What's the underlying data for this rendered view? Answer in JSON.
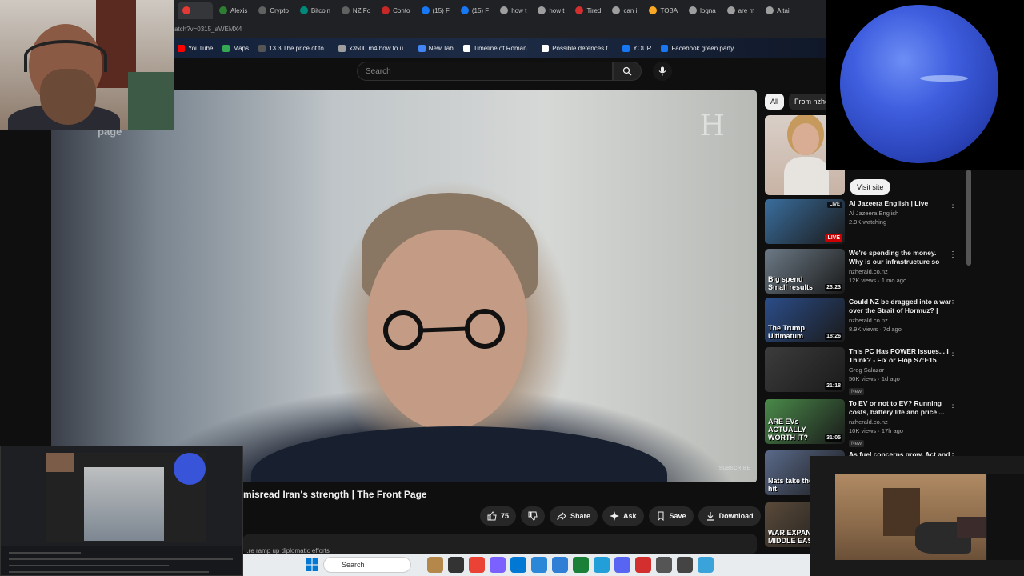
{
  "browser": {
    "tabs": [
      {
        "label": "",
        "color": "#e53935"
      },
      {
        "label": "Alexis",
        "color": "#2e7d32"
      },
      {
        "label": "Crypto",
        "color": "#616161"
      },
      {
        "label": "Bitcoin",
        "color": "#00897b"
      },
      {
        "label": "NZ Fo",
        "color": "#616161"
      },
      {
        "label": "Conto",
        "color": "#c62828"
      },
      {
        "label": "(15) F",
        "color": "#1877f2"
      },
      {
        "label": "(15) F",
        "color": "#1877f2"
      },
      {
        "label": "how t",
        "color": "#9e9e9e"
      },
      {
        "label": "how t",
        "color": "#9e9e9e"
      },
      {
        "label": "Tired",
        "color": "#d32f2f"
      },
      {
        "label": "can i",
        "color": "#9e9e9e"
      },
      {
        "label": "TOBA",
        "color": "#f9a825"
      },
      {
        "label": "logna",
        "color": "#9e9e9e"
      },
      {
        "label": "are m",
        "color": "#9e9e9e"
      },
      {
        "label": "Altai",
        "color": "#9e9e9e"
      }
    ],
    "url": "atch?v=0315_aWEMX4",
    "bookmarks": [
      {
        "label": "YouTube",
        "color": "#ff0000"
      },
      {
        "label": "Maps",
        "color": "#34a853"
      },
      {
        "label": "13.3 The price of to...",
        "color": "#555555"
      },
      {
        "label": "x3500 m4 how to u...",
        "color": "#9e9e9e"
      },
      {
        "label": "New Tab",
        "color": "#4285f4"
      },
      {
        "label": "Timeline of Roman...",
        "color": "#ffffff"
      },
      {
        "label": "Possible defences t...",
        "color": "#ffffff"
      },
      {
        "label": "YOUR",
        "color": "#1877f2"
      },
      {
        "label": "Facebook green party",
        "color": "#1877f2"
      }
    ]
  },
  "youtube": {
    "search_placeholder": "Search",
    "video": {
      "title_fragment": "misread Iran's strength | The Front Page",
      "watermark": "H",
      "subscribe_tag": "SUBSCRIBE",
      "page_tag": "page",
      "likes": "75",
      "actions": {
        "share": "Share",
        "ask": "Ask",
        "save": "Save",
        "download": "Download"
      },
      "description_snippet": "...re ramp up diplomatic efforts"
    },
    "sidebar": {
      "chips": [
        "All",
        "From nzhe"
      ],
      "ad": {
        "visit_label": "Visit site"
      },
      "recommendations": [
        {
          "title": "Al Jazeera English | Live",
          "channel": "Al Jazeera English",
          "meta": "2.9K watching",
          "badge": "LIVE",
          "live": true,
          "thumb_color": "#3a6e9e"
        },
        {
          "title": "We're spending the money. Why is our infrastructure so bad? | ...",
          "channel": "nzherald.co.nz",
          "meta": "12K views · 1 mo ago",
          "overlay": "Big spend Small results",
          "duration": "23:23",
          "thumb_color": "#6c7a86"
        },
        {
          "title": "Could NZ be dragged into a war over the Strait of Hormuz? | Th...",
          "channel": "nzherald.co.nz",
          "meta": "8.9K views · 7d ago",
          "overlay": "The Trump Ultimatum",
          "duration": "18:26",
          "thumb_color": "#2b4d8a"
        },
        {
          "title": "This PC Has POWER Issues... I Think? - Fix or Flop S7:E15",
          "channel": "Greg Salazar",
          "meta": "50K views · 1d ago",
          "new": "New",
          "duration": "21:18",
          "thumb_color": "#3c3c3c"
        },
        {
          "title": "To EV or not to EV? Running costs, battery life and price ...",
          "channel": "nzherald.co.nz",
          "meta": "10K views · 17h ago",
          "new": "New",
          "overlay": "ARE EVs ACTUALLY WORTH IT?",
          "duration": "31:05",
          "thumb_color": "#4a8a4a"
        },
        {
          "title": "As fuel concerns grow, Act and",
          "channel": "",
          "meta": "",
          "overlay": "Nats take the hit",
          "thumb_color": "#5a6a8a"
        },
        {
          "title": "",
          "channel": "",
          "meta": "",
          "overlay": "WAR EXPAN MIDDLE EAST",
          "thumb_color": "#5a4a3a"
        }
      ]
    }
  },
  "taskbar": {
    "search_label": "Search",
    "icons": [
      "#b4884a",
      "#333333",
      "#ea4335",
      "#7b61ff",
      "#0078d4",
      "#2b88d8",
      "#2f7fd6",
      "#1a7f37",
      "#229ed9",
      "#5865f2",
      "#d32f2f",
      "#555555",
      "#444444",
      "#3aa3d9"
    ]
  },
  "colors": {
    "accent": "#ff0000",
    "background": "#0f0f0f",
    "text": "#f1f1f1",
    "muted": "#aaaaaa"
  }
}
